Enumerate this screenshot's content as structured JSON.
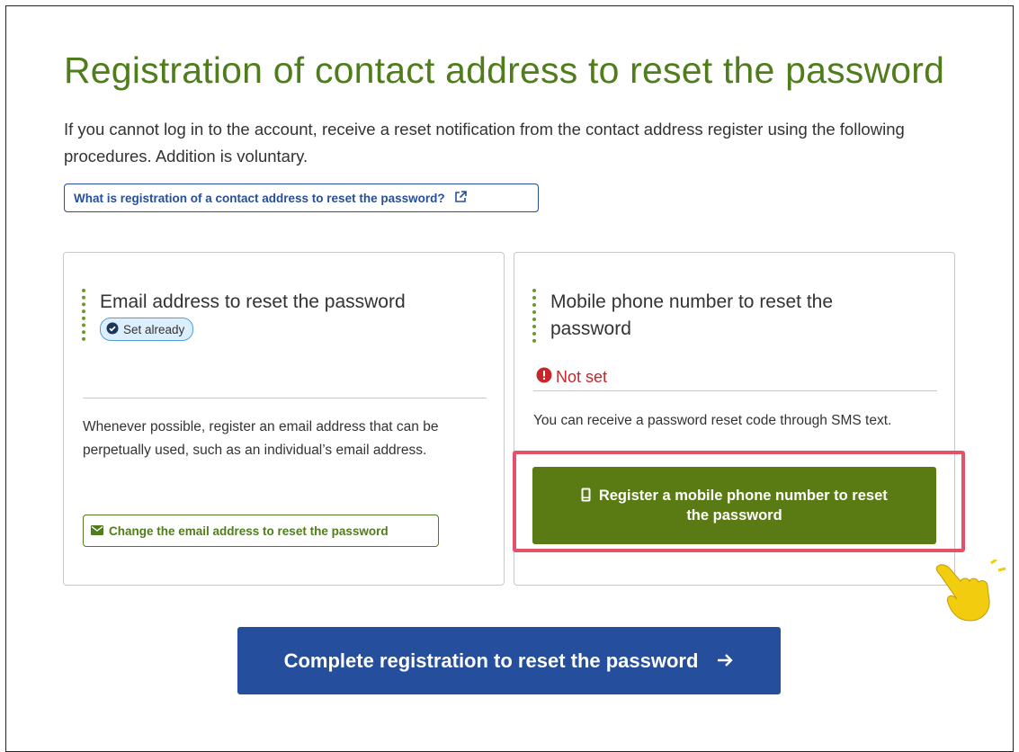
{
  "page": {
    "title": "Registration of contact address to reset the password",
    "intro": "If you cannot log in to the account, receive a reset notification from the contact address register using the following procedures. Addition is voluntary.",
    "help_link": {
      "label": "What is registration of a contact address to reset the password?",
      "icon": "external-link-icon"
    }
  },
  "email_card": {
    "title": "Email address to reset the password",
    "status_badge": "Set already",
    "status_icon": "check-circle-icon",
    "description": "Whenever possible, register an email address that can be perpetually used, such as an individual’s email address.",
    "change_button": "Change the email address to reset the password",
    "change_icon": "envelope-icon"
  },
  "mobile_card": {
    "title": "Mobile phone number to reset the password",
    "status": "Not set",
    "status_icon": "exclamation-circle-icon",
    "description": "You can receive a password reset code through SMS text.",
    "register_button": "Register a mobile phone number to reset the password",
    "register_icon": "mobile-phone-icon"
  },
  "complete_button": {
    "label": "Complete registration to reset the password",
    "icon": "arrow-right-icon"
  },
  "colors": {
    "heading_green": "#4f7d1c",
    "button_green": "#5a7b13",
    "primary_blue": "#254f9c",
    "error_red": "#c8262b",
    "highlight_pink": "#e2536a",
    "pointer_yellow": "#f2cd0f"
  }
}
